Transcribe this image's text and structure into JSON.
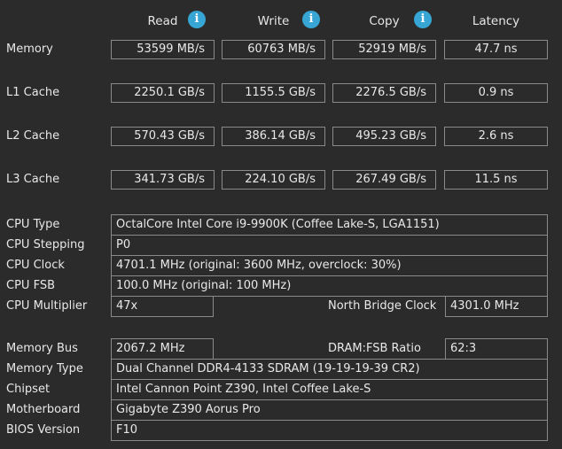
{
  "columns": {
    "read": "Read",
    "write": "Write",
    "copy": "Copy",
    "latency": "Latency"
  },
  "bench": [
    {
      "label": "Memory",
      "read": "53599 MB/s",
      "write": "60763 MB/s",
      "copy": "52919 MB/s",
      "latency": "47.7 ns"
    },
    {
      "label": "L1 Cache",
      "read": "2250.1 GB/s",
      "write": "1155.5 GB/s",
      "copy": "2276.5 GB/s",
      "latency": "0.9 ns"
    },
    {
      "label": "L2 Cache",
      "read": "570.43 GB/s",
      "write": "386.14 GB/s",
      "copy": "495.23 GB/s",
      "latency": "2.6 ns"
    },
    {
      "label": "L3 Cache",
      "read": "341.73 GB/s",
      "write": "224.10 GB/s",
      "copy": "267.49 GB/s",
      "latency": "11.5 ns"
    }
  ],
  "cpu": {
    "type_label": "CPU Type",
    "type": "OctalCore Intel Core i9-9900K  (Coffee Lake-S, LGA1151)",
    "stepping_label": "CPU Stepping",
    "stepping": "P0",
    "clock_label": "CPU Clock",
    "clock": "4701.1 MHz  (original: 3600 MHz, overclock: 30%)",
    "fsb_label": "CPU FSB",
    "fsb": "100.0 MHz  (original: 100 MHz)",
    "multiplier_label": "CPU Multiplier",
    "multiplier": "47x",
    "nb_clock_label": "North Bridge Clock",
    "nb_clock": "4301.0 MHz"
  },
  "memory": {
    "bus_label": "Memory Bus",
    "bus": "2067.2 MHz",
    "ratio_label": "DRAM:FSB Ratio",
    "ratio": "62:3",
    "type_label": "Memory Type",
    "type": "Dual Channel DDR4-4133 SDRAM  (19-19-19-39 CR2)",
    "chipset_label": "Chipset",
    "chipset": "Intel Cannon Point Z390, Intel Coffee Lake-S",
    "motherboard_label": "Motherboard",
    "motherboard": "Gigabyte Z390 Aorus Pro",
    "bios_label": "BIOS Version",
    "bios": "F10"
  },
  "icons": {
    "info": "info-icon",
    "accent": "#37a6d4"
  }
}
